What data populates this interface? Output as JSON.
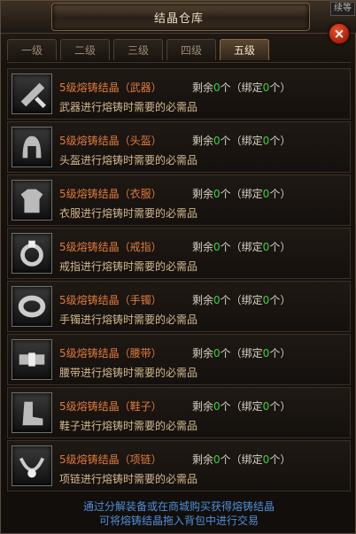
{
  "window": {
    "title": "结晶仓库",
    "corner_label": "续等",
    "close_label": "×"
  },
  "tabs": [
    {
      "label": "一级",
      "active": false
    },
    {
      "label": "二级",
      "active": false
    },
    {
      "label": "三级",
      "active": false
    },
    {
      "label": "四级",
      "active": false
    },
    {
      "label": "五级",
      "active": true
    }
  ],
  "items": [
    {
      "icon": "weapon-crystal-icon",
      "name": "5级熔铸结晶（武器）",
      "remain_prefix": "剩余",
      "remain": "0",
      "bound_prefix": "个（绑定",
      "bound": "0",
      "bound_suffix": "个）",
      "desc": "武器进行熔铸时需要的必需品"
    },
    {
      "icon": "helmet-crystal-icon",
      "name": "5级熔铸结晶（头盔）",
      "remain_prefix": "剩余",
      "remain": "0",
      "bound_prefix": "个（绑定",
      "bound": "0",
      "bound_suffix": "个）",
      "desc": "头盔进行熔铸时需要的必需品"
    },
    {
      "icon": "armor-crystal-icon",
      "name": "5级熔铸结晶（衣服）",
      "remain_prefix": "剩余",
      "remain": "0",
      "bound_prefix": "个（绑定",
      "bound": "0",
      "bound_suffix": "个）",
      "desc": "衣服进行熔铸时需要的必需品"
    },
    {
      "icon": "ring-crystal-icon",
      "name": "5级熔铸结晶（戒指）",
      "remain_prefix": "剩余",
      "remain": "0",
      "bound_prefix": "个（绑定",
      "bound": "0",
      "bound_suffix": "个）",
      "desc": "戒指进行熔铸时需要的必需品"
    },
    {
      "icon": "bracelet-crystal-icon",
      "name": "5级熔铸结晶（手镯）",
      "remain_prefix": "剩余",
      "remain": "0",
      "bound_prefix": "个（绑定",
      "bound": "0",
      "bound_suffix": "个）",
      "desc": "手镯进行熔铸时需要的必需品"
    },
    {
      "icon": "belt-crystal-icon",
      "name": "5级熔铸结晶（腰带）",
      "remain_prefix": "剩余",
      "remain": "0",
      "bound_prefix": "个（绑定",
      "bound": "0",
      "bound_suffix": "个）",
      "desc": "腰带进行熔铸时需要的必需品"
    },
    {
      "icon": "boots-crystal-icon",
      "name": "5级熔铸结晶（鞋子）",
      "remain_prefix": "剩余",
      "remain": "0",
      "bound_prefix": "个（绑定",
      "bound": "0",
      "bound_suffix": "个）",
      "desc": "鞋子进行熔铸时需要的必需品"
    },
    {
      "icon": "necklace-crystal-icon",
      "name": "5级熔铸结晶（项链）",
      "remain_prefix": "剩余",
      "remain": "0",
      "bound_prefix": "个（绑定",
      "bound": "0",
      "bound_suffix": "个）",
      "desc": "项链进行熔铸时需要的必需品"
    }
  ],
  "footer": {
    "line1": "通过分解装备或在商城购买获得熔铸结晶",
    "line2": "可将熔铸结晶拖入背包中进行交易"
  },
  "colors": {
    "item_name": "#e07a3a",
    "count": "#3ad23a",
    "desc": "#d2b98f",
    "footer": "#4f8fd8"
  }
}
